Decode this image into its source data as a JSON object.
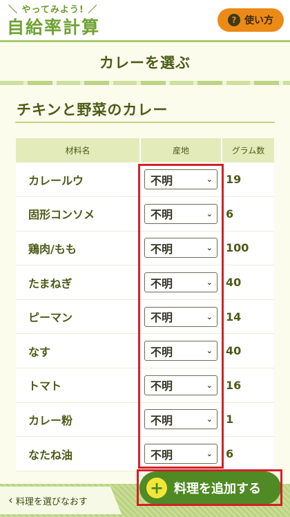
{
  "app": {
    "subtitle": "＼ やってみよう! ／",
    "title": "自給率計算",
    "help_label": "使い方",
    "help_icon": "question-icon"
  },
  "page": {
    "heading": "カレーを選ぶ",
    "dish_name": "チキンと野菜のカレー"
  },
  "table": {
    "headers": {
      "name": "材料名",
      "origin": "産地",
      "grams": "グラム数"
    },
    "rows": [
      {
        "name": "カレールウ",
        "origin": "不明",
        "grams": "19"
      },
      {
        "name": "固形コンソメ",
        "origin": "不明",
        "grams": "6"
      },
      {
        "name": "鶏肉/もも",
        "origin": "不明",
        "grams": "100"
      },
      {
        "name": "たまねぎ",
        "origin": "不明",
        "grams": "40"
      },
      {
        "name": "ピーマン",
        "origin": "不明",
        "grams": "14"
      },
      {
        "name": "なす",
        "origin": "不明",
        "grams": "40"
      },
      {
        "name": "トマト",
        "origin": "不明",
        "grams": "16"
      },
      {
        "name": "カレー粉",
        "origin": "不明",
        "grams": "1"
      },
      {
        "name": "なたね油",
        "origin": "不明",
        "grams": "6"
      }
    ]
  },
  "footer": {
    "back_label": "料理を選びなおす",
    "add_label": "料理を追加する"
  },
  "colors": {
    "accent_green": "#6fa232",
    "button_green": "#4f8a24",
    "help_orange": "#ec8a17",
    "highlight_red": "#d32027"
  }
}
